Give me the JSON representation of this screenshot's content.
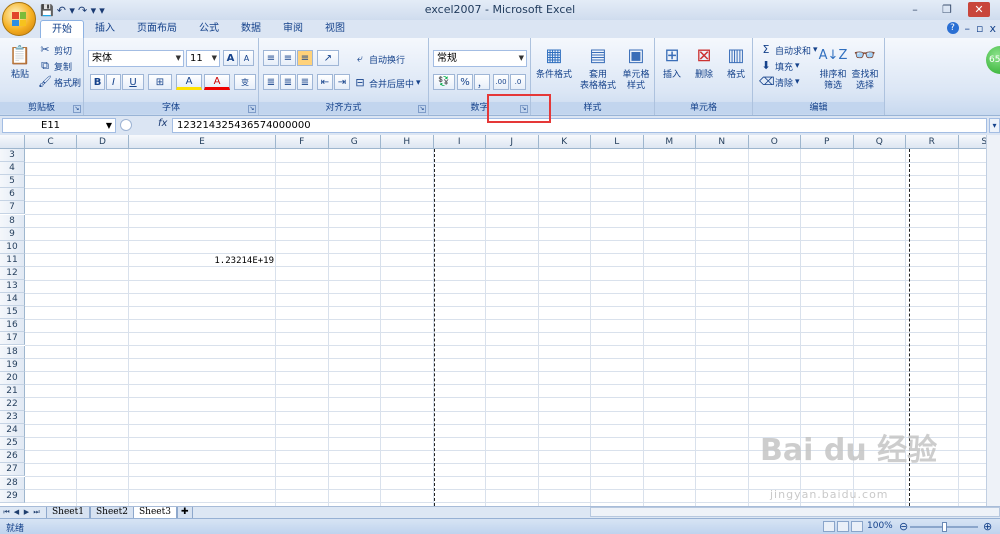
{
  "window": {
    "title": "excel2007 - Microsoft Excel",
    "minimize": "–",
    "restore": "❐",
    "close": "✕"
  },
  "qat": {
    "save": "💾",
    "undo": "↶ ▾",
    "redo": "↷ ▾",
    "more": "▾"
  },
  "tabs": [
    {
      "label": "开始",
      "active": true
    },
    {
      "label": "插入",
      "active": false
    },
    {
      "label": "页面布局",
      "active": false
    },
    {
      "label": "公式",
      "active": false
    },
    {
      "label": "数据",
      "active": false
    },
    {
      "label": "审阅",
      "active": false
    },
    {
      "label": "视图",
      "active": false
    }
  ],
  "tabs_right": {
    "help": "?",
    "min": "–",
    "restore": "▫",
    "close": "x"
  },
  "ribbon": {
    "clipboard": {
      "label": "剪贴板",
      "paste": "粘贴",
      "cut": "剪切",
      "copy": "复制",
      "format_painter": "格式刷"
    },
    "font": {
      "label": "字体",
      "name": "宋体",
      "size": "11",
      "grow": "A",
      "shrink": "A",
      "bold": "B",
      "italic": "I",
      "underline": "U",
      "border": "⊞",
      "fill": "A",
      "color": "A",
      "phonetic": "变"
    },
    "alignment": {
      "label": "对齐方式",
      "wrap": "自动换行",
      "merge": "合并后居中"
    },
    "number": {
      "label": "数字",
      "format": "常规",
      "currency": "💱",
      "percent": "%",
      "comma": "，",
      "inc": ".00",
      "dec": ".0"
    },
    "styles": {
      "label": "样式",
      "conditional": "条件格式",
      "table_line1": "套用",
      "table_line2": "表格格式",
      "cell_line1": "单元格",
      "cell_line2": "样式"
    },
    "cells": {
      "label": "单元格",
      "insert": "插入",
      "delete": "删除",
      "format": "格式"
    },
    "editing": {
      "label": "编辑",
      "autosum": "自动求和",
      "fill": "填充",
      "clear": "清除",
      "sort_line1": "排序和",
      "sort_line2": "筛选",
      "find_line1": "查找和",
      "find_line2": "选择"
    }
  },
  "badge": "65",
  "formula_bar": {
    "name_box": "E11",
    "fx": "fx",
    "formula": "123214325436574000000"
  },
  "columns": [
    "C",
    "D",
    "E",
    "F",
    "G",
    "H",
    "I",
    "J",
    "K",
    "L",
    "M",
    "N",
    "O",
    "P",
    "Q",
    "R",
    "S"
  ],
  "rows": [
    "3",
    "4",
    "5",
    "6",
    "7",
    "8",
    "9",
    "10",
    "11",
    "12",
    "13",
    "14",
    "15",
    "16",
    "17",
    "18",
    "19",
    "20",
    "21",
    "22",
    "23",
    "24",
    "25",
    "26",
    "27",
    "28",
    "29"
  ],
  "cell_e11": "1.23214E+19",
  "sheets": [
    {
      "label": "Sheet1",
      "active": false
    },
    {
      "label": "Sheet2",
      "active": false
    },
    {
      "label": "Sheet3",
      "active": true
    }
  ],
  "status": {
    "text": "就绪",
    "zoom": "100%"
  },
  "watermark": {
    "brand": "Bai du 经验",
    "url": "jingyan.baidu.com"
  }
}
